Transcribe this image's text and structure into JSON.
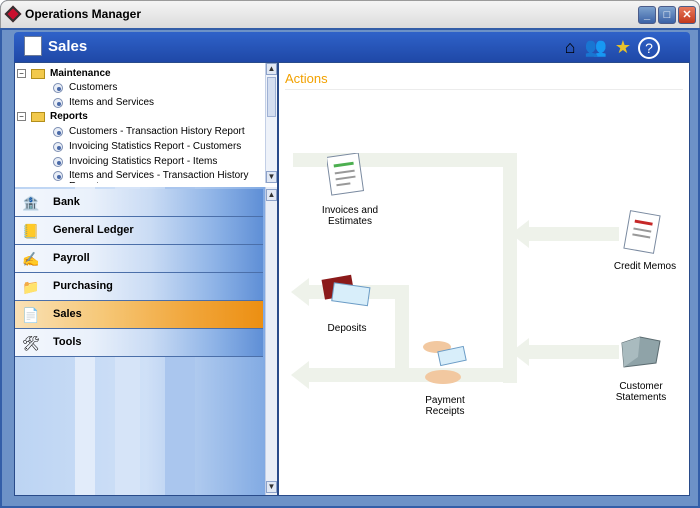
{
  "window": {
    "title": "Operations Manager"
  },
  "header": {
    "title": "Sales"
  },
  "tree": {
    "groups": [
      {
        "label": "Maintenance",
        "items": [
          "Customers",
          "Items and Services"
        ]
      },
      {
        "label": "Reports",
        "items": [
          "Customers - Transaction History Report",
          "Invoicing Statistics Report - Customers",
          "Invoicing Statistics Report - Items",
          "Items and Services - Transaction History Report"
        ]
      }
    ]
  },
  "nav": {
    "items": [
      "Bank",
      "General Ledger",
      "Payroll",
      "Purchasing",
      "Sales",
      "Tools"
    ],
    "active": "Sales"
  },
  "main": {
    "title": "Actions",
    "nodes": {
      "invoices": "Invoices and Estimates",
      "deposits": "Deposits",
      "payment": "Payment Receipts",
      "credit": "Credit Memos",
      "statements": "Customer Statements"
    }
  },
  "colors": {
    "accent": "#f2a100",
    "active_nav": "#ec8f12",
    "frame": "#335ea8"
  }
}
